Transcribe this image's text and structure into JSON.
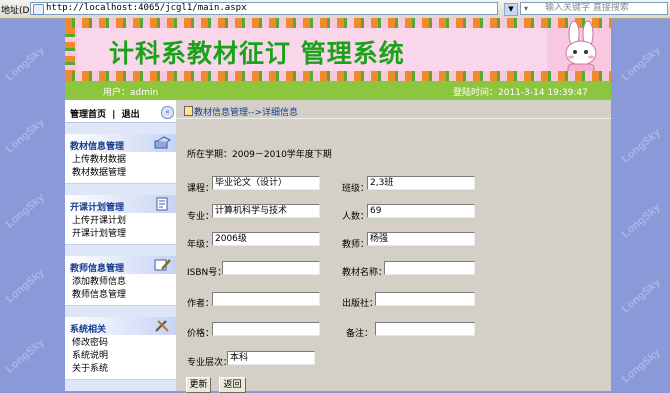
{
  "browser": {
    "address_label": "地址(D)",
    "url": "http://localhost:4065/jcgl1/main.aspx",
    "search_placeholder": "输入关键字 直接搜索"
  },
  "watermark": "LongSky",
  "header": {
    "title": "计科系教材征订 管理系统",
    "user_label": "用户：admin",
    "login_time": "登陆时间：2011-3-14 19:39:47"
  },
  "sidebar": {
    "home": "管理首页",
    "separator": "|",
    "logout": "退出",
    "collapse_icon": "«",
    "groups": [
      {
        "title": "教材信息管理",
        "items": [
          "上传教材数据",
          "教材数据管理"
        ]
      },
      {
        "title": "开课计划管理",
        "items": [
          "上传开课计划",
          "开课计划管理"
        ]
      },
      {
        "title": "教师信息管理",
        "items": [
          "添加教师信息",
          "教师信息管理"
        ]
      },
      {
        "title": "系统相关",
        "items": [
          "修改密码",
          "系统说明",
          "关于系统"
        ]
      }
    ]
  },
  "content": {
    "breadcrumb": "教材信息管理-->详细信息",
    "term": "所在学期：2009－2010学年度下期",
    "form": {
      "course_label": "课程：",
      "course_value": "毕业论文（设计）",
      "class_label": "班级：",
      "class_value": "2,3班",
      "major_label": "专业：",
      "major_value": "计算机科学与技术",
      "count_label": "人数：",
      "count_value": "69",
      "grade_label": "年级：",
      "grade_value": "2006级",
      "teacher_label": "教师：",
      "teacher_value": "杨强",
      "isbn_label": "ISBN号：",
      "isbn_value": "",
      "book_label": "教材名称：",
      "book_value": "",
      "author_label": "作者：",
      "author_value": "",
      "publisher_label": "出版社：",
      "publisher_value": "",
      "price_label": "价格：",
      "price_value": "",
      "note_label": "备注：",
      "note_value": "",
      "level_label": "专业层次：",
      "level_value": "本科"
    },
    "buttons": {
      "update": "更新",
      "back": "返回"
    }
  }
}
